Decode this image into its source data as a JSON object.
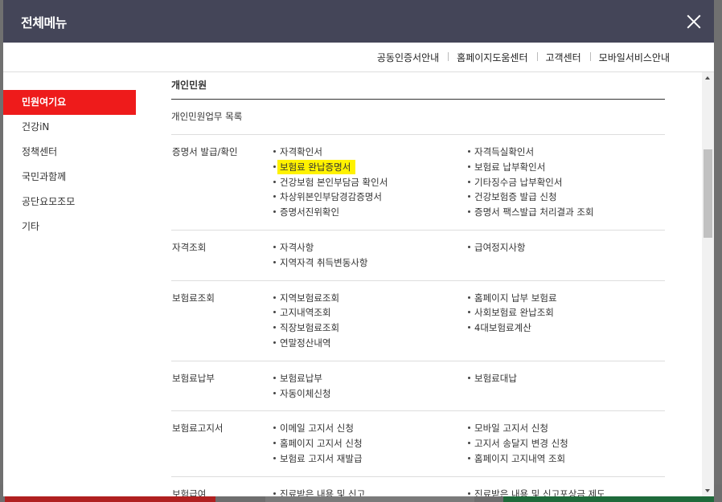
{
  "modal": {
    "title": "전체메뉴",
    "close_icon": "close-icon"
  },
  "topbar": {
    "links": [
      "공동인증서안내",
      "홈페이지도움센터",
      "고객센터",
      "모바일서비스안내"
    ]
  },
  "sidebar": {
    "items": [
      {
        "label": "민원여기요",
        "active": true
      },
      {
        "label": "건강iN",
        "active": false
      },
      {
        "label": "정책센터",
        "active": false
      },
      {
        "label": "국민과함께",
        "active": false
      },
      {
        "label": "공단요모조모",
        "active": false
      },
      {
        "label": "기타",
        "active": false
      }
    ]
  },
  "content": {
    "heading": "개인민원",
    "subheading": "개인민원업무 목록",
    "sections": [
      {
        "label": "증명서 발급/확인",
        "left": [
          "자격확인서",
          "보험료 완납증명서",
          "건강보험 본인부담금 확인서",
          "차상위본인부담경감증명서",
          "증명서진위확인"
        ],
        "right": [
          "자격득실확인서",
          "보험료 납부확인서",
          "기타징수금 납부확인서",
          "건강보험증 발급 신청",
          "증명서 팩스발급 처리결과 조회"
        ]
      },
      {
        "label": "자격조회",
        "left": [
          "자격사항",
          "지역자격 취득변동사항"
        ],
        "right": [
          "급여정지사항"
        ]
      },
      {
        "label": "보험료조회",
        "left": [
          "지역보험료조회",
          "고지내역조회",
          "직장보험료조회",
          "연말정산내역"
        ],
        "right": [
          "홈페이지 납부 보험료",
          "사회보험료 완납조회",
          "4대보험료계산"
        ]
      },
      {
        "label": "보험료납부",
        "left": [
          "보험료납부",
          "자동이체신청"
        ],
        "right": [
          "보험료대납"
        ]
      },
      {
        "label": "보험료고지서",
        "left": [
          "이메일 고지서 신청",
          "홈페이지 고지서 신청",
          "보험료 고지서 재발급"
        ],
        "right": [
          "모바일 고지서 신청",
          "고지서 송달지 변경 신청",
          "홈페이지 고지내역 조회"
        ]
      },
      {
        "label": "보험급여",
        "left": [
          "진료받은 내용 및 신고"
        ],
        "right": [
          "진료받은 내용 및 신고포상금 제도"
        ]
      }
    ],
    "highlighted_item": "보험료 완납증명서",
    "highlight_color": "#fff200"
  },
  "colors": {
    "header_bg": "#444558",
    "active_menu": "#ee1b1b"
  }
}
